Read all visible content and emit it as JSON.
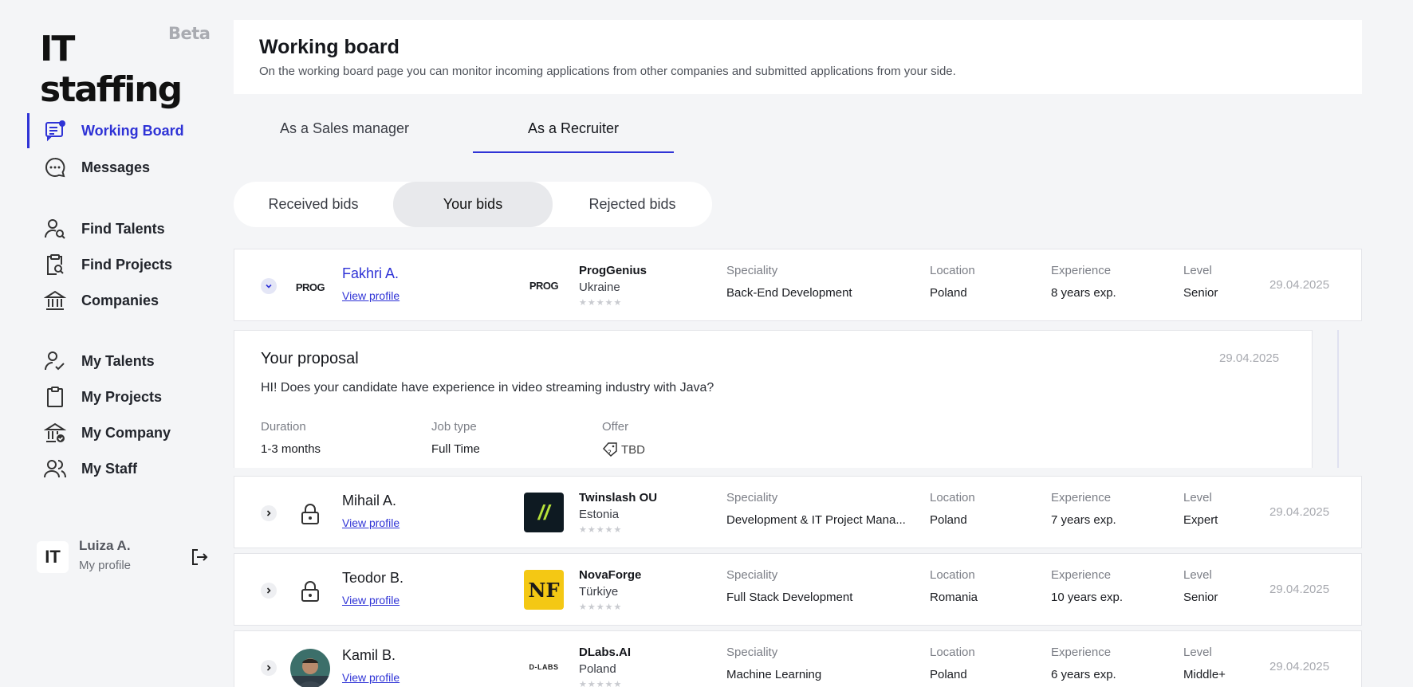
{
  "brand": {
    "name": "IT staffing",
    "badge": "Beta"
  },
  "sidebar": {
    "items": [
      {
        "label": "Working Board",
        "icon": "working-board-icon",
        "active": true
      },
      {
        "label": "Messages",
        "icon": "chat-icon"
      },
      {
        "label": "Find Talents",
        "icon": "user-search-icon"
      },
      {
        "label": "Find Projects",
        "icon": "clipboard-search-icon"
      },
      {
        "label": "Companies",
        "icon": "bank-icon"
      },
      {
        "label": "My Talents",
        "icon": "user-check-icon"
      },
      {
        "label": "My Projects",
        "icon": "clipboard-icon"
      },
      {
        "label": "My Company",
        "icon": "bank-check-icon"
      },
      {
        "label": "My Staff",
        "icon": "users-icon"
      }
    ],
    "user": {
      "initials": "IT",
      "name": "Luiza A.",
      "subtitle": "My profile"
    }
  },
  "header": {
    "title": "Working board",
    "description": "On the working board page you can monitor incoming applications from other companies and submitted applications from your side."
  },
  "role_tabs": [
    {
      "label": "As a Sales manager",
      "active": false
    },
    {
      "label": "As a Recruiter",
      "active": true
    }
  ],
  "bid_tabs": [
    {
      "label": "Received bids",
      "active": false
    },
    {
      "label": "Your bids",
      "active": true
    },
    {
      "label": "Rejected bids",
      "active": false
    }
  ],
  "columns": {
    "speciality": "Speciality",
    "location": "Location",
    "experience": "Experience",
    "level": "Level"
  },
  "view_profile_label": "View profile",
  "bids": [
    {
      "candidate": "Fakhri A.",
      "company": "ProgGenius",
      "country": "Ukraine",
      "speciality": "Back-End Development",
      "location": "Poland",
      "experience": "8 years exp.",
      "level": "Senior",
      "date": "29.04.2025",
      "expanded": true,
      "logo_text": "PROG"
    },
    {
      "candidate": "Mihail A.",
      "company": "Twinslash OU",
      "country": "Estonia",
      "speciality": "Development & IT Project Mana...",
      "location": "Poland",
      "experience": "7 years exp.",
      "level": "Expert",
      "date": "29.04.2025",
      "expanded": false,
      "logo_text": "//"
    },
    {
      "candidate": "Teodor B.",
      "company": "NovaForge",
      "country": "Türkiye",
      "speciality": "Full Stack Development",
      "location": "Romania",
      "experience": "10 years exp.",
      "level": "Senior",
      "date": "29.04.2025",
      "expanded": false,
      "logo_text": "NF"
    },
    {
      "candidate": "Kamil B.",
      "company": "DLabs.AI",
      "country": "Poland",
      "speciality": "Machine Learning",
      "location": "Poland",
      "experience": "6 years exp.",
      "level": "Middle+",
      "date": "29.04.2025",
      "expanded": false,
      "logo_text": "D-LABS"
    }
  ],
  "proposal": {
    "title": "Your proposal",
    "date": "29.04.2025",
    "message": "HI! Does your candidate have experience in video streaming industry with Java?",
    "duration_label": "Duration",
    "duration": "1-3 months",
    "job_type_label": "Job type",
    "job_type": "Full Time",
    "offer_label": "Offer",
    "offer": "TBD"
  },
  "stars": "★★★★★",
  "colors": {
    "accent": "#2f33d6",
    "nova_yellow": "#f4c814",
    "twinslash_bg": "#0e1a22",
    "twinslash_fg": "#b7e23a"
  }
}
